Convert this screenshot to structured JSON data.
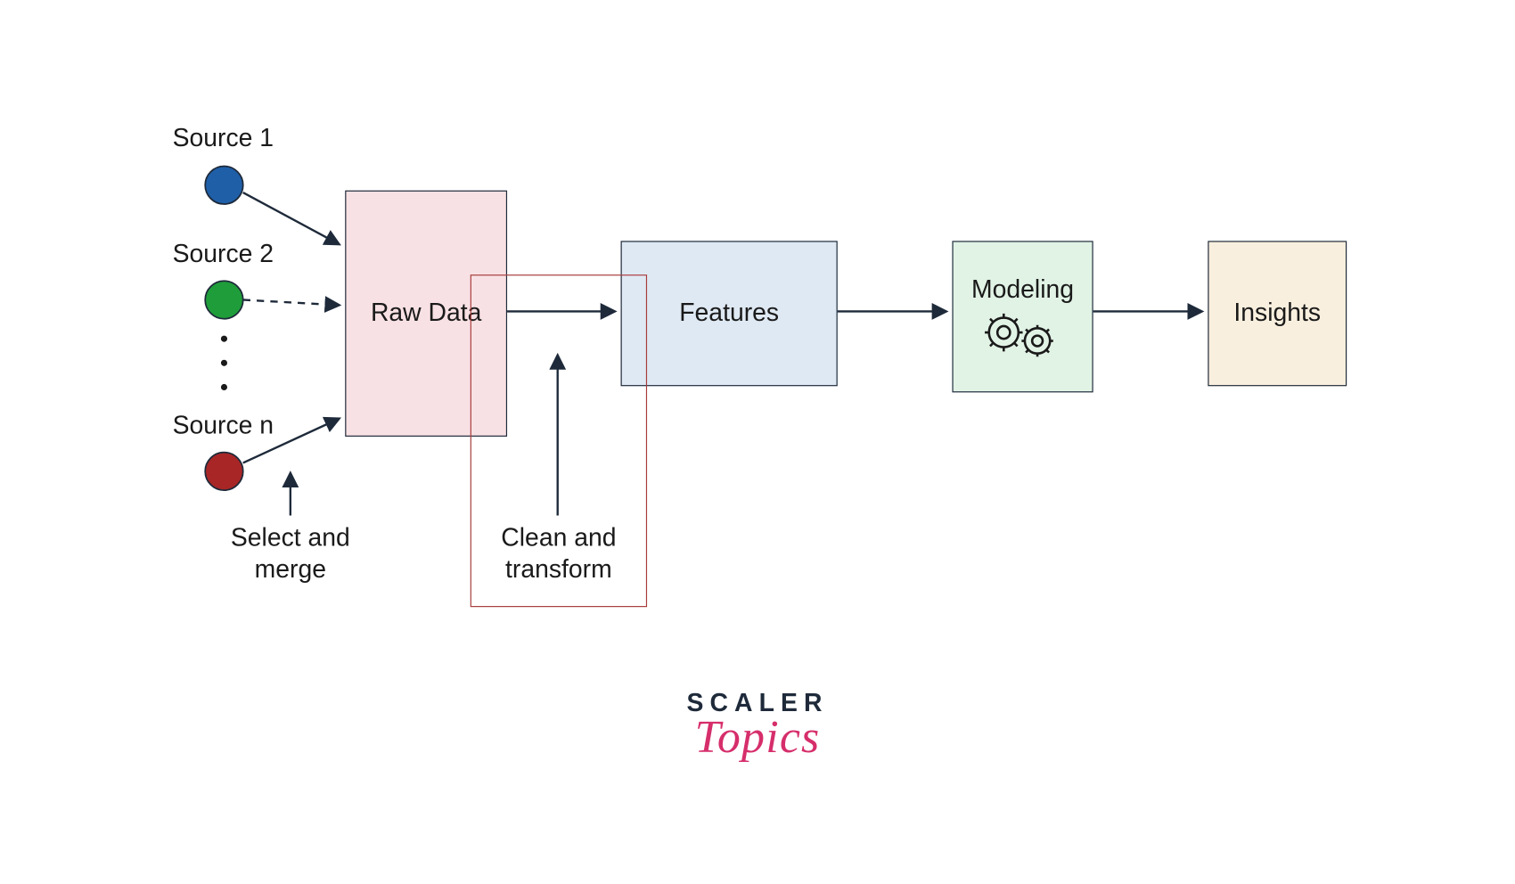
{
  "sources": {
    "s1": {
      "label": "Source 1",
      "color": "#1f5fa8"
    },
    "s2": {
      "label": "Source 2",
      "color": "#1f9d3a"
    },
    "sn": {
      "label": "Source n",
      "color": "#a82626"
    }
  },
  "boxes": {
    "raw": "Raw Data",
    "features": "Features",
    "modeling": "Modeling",
    "insights": "Insights"
  },
  "annotations": {
    "select_merge_l1": "Select and",
    "select_merge_l2": "merge",
    "clean_transform_l1": "Clean and",
    "clean_transform_l2": "transform"
  },
  "logo": {
    "top": "SCALER",
    "bottom": "Topics"
  },
  "colors": {
    "stroke": "#1e2a3a",
    "red_outline": "#a83c3c"
  }
}
